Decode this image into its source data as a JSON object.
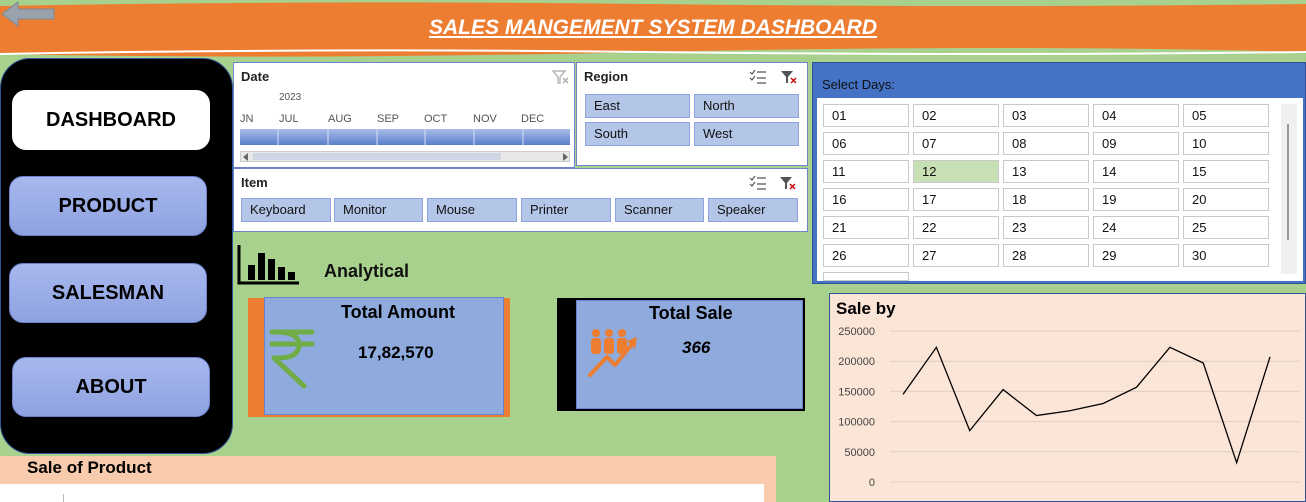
{
  "header": {
    "title": "SALES MANGEMENT SYSTEM DASHBOARD"
  },
  "nav": {
    "items": [
      {
        "label": "DASHBOARD"
      },
      {
        "label": "PRODUCT"
      },
      {
        "label": "SALESMAN"
      },
      {
        "label": "ABOUT"
      }
    ]
  },
  "date_slicer": {
    "title": "Date",
    "year": "2023",
    "months": [
      "JN",
      "JUL",
      "AUG",
      "SEP",
      "OCT",
      "NOV",
      "DEC"
    ]
  },
  "region_slicer": {
    "title": "Region",
    "items": [
      "East",
      "North",
      "South",
      "West"
    ]
  },
  "item_slicer": {
    "title": "Item",
    "items": [
      "Keyboard",
      "Monitor",
      "Mouse",
      "Printer",
      "Scanner",
      "Speaker"
    ]
  },
  "days_slicer": {
    "label": "Select Days:",
    "days": [
      "01",
      "02",
      "03",
      "04",
      "05",
      "06",
      "07",
      "08",
      "09",
      "10",
      "11",
      "12",
      "13",
      "14",
      "15",
      "16",
      "17",
      "18",
      "19",
      "20",
      "21",
      "22",
      "23",
      "24",
      "25",
      "26",
      "27",
      "28",
      "29",
      "30"
    ],
    "selected": "12"
  },
  "analytical": {
    "label": "Analytical"
  },
  "cards": {
    "total_amount": {
      "title": "Total Amount",
      "value": "17,82,570"
    },
    "total_sale": {
      "title": "Total Sale",
      "value": "366"
    }
  },
  "sale_of_product": {
    "title": "Sale of Product"
  },
  "colors": {
    "header": "#ed7d31",
    "background": "#a9d18e",
    "accent_blue": "#4472c4",
    "card": "#8faadc",
    "chart_bg": "#fbe5d6",
    "rupee_icon": "#70ad47",
    "people_icon": "#ed7d31"
  },
  "icons": {
    "back": "back-arrow-icon",
    "rupee": "rupee-icon",
    "people": "people-growth-icon",
    "bar_chart": "bar-chart-icon",
    "multi_select": "multi-select-icon",
    "clear_filter": "clear-filter-icon"
  },
  "chart_data": {
    "type": "line",
    "title": "Sale by",
    "ylim": [
      0,
      250000
    ],
    "yticks": [
      "250000",
      "200000",
      "150000",
      "100000",
      "50000",
      "0"
    ],
    "ytick_values": [
      250000,
      200000,
      150000,
      100000,
      50000,
      0
    ],
    "values": [
      145000,
      223000,
      85000,
      153000,
      110000,
      118000,
      130000,
      157000,
      223000,
      197000,
      32000,
      207000
    ],
    "grid": true
  }
}
